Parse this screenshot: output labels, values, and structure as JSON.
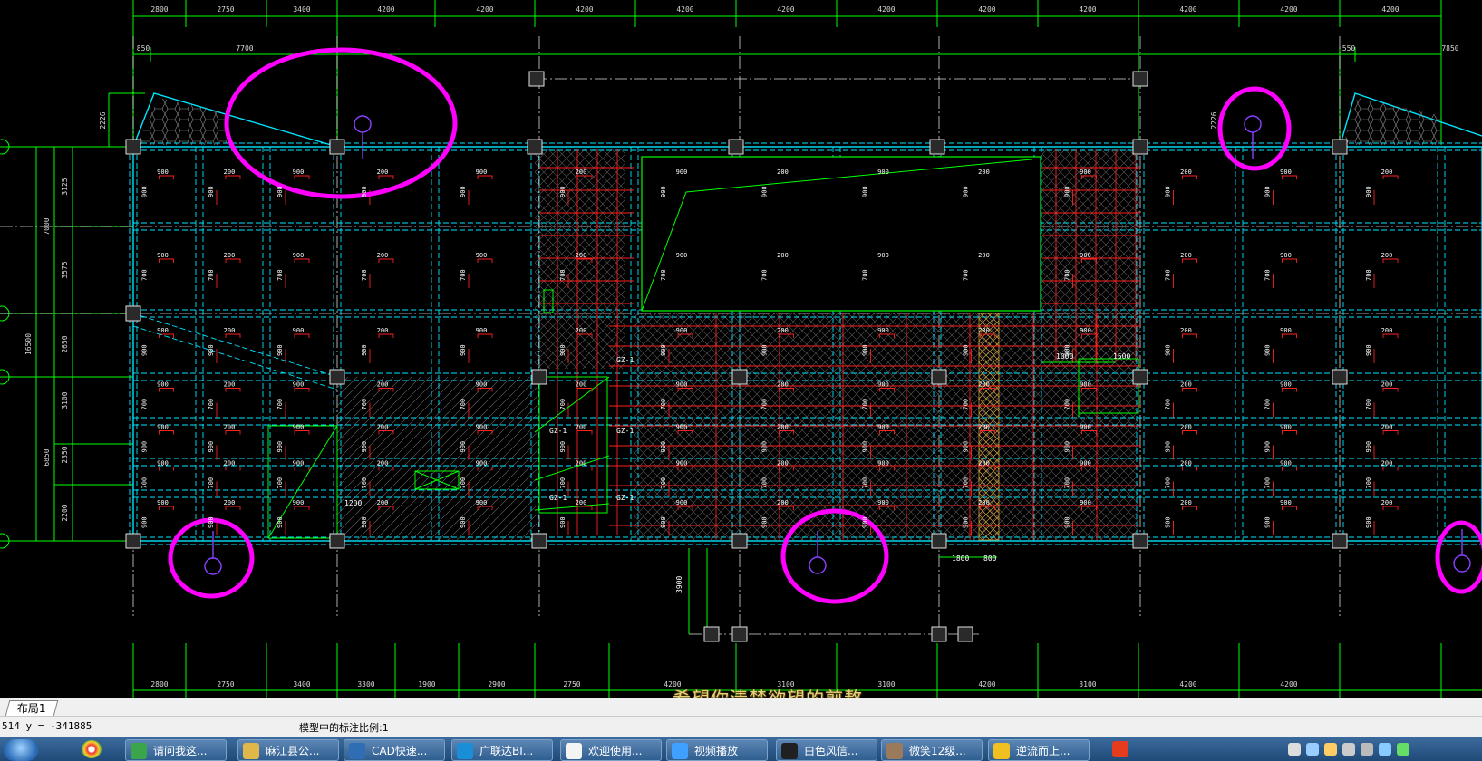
{
  "drawing": {
    "top_dims": [
      "2800",
      "2750",
      "3400",
      "4200",
      "4200",
      "4200",
      "4200",
      "4200",
      "4200",
      "4200",
      "4200",
      "4200",
      "4200",
      "4200"
    ],
    "top_sub_dims": [
      "850",
      "7700",
      "550",
      "7850"
    ],
    "bottom_dims": [
      "2800",
      "2750",
      "3400",
      "3300",
      "1900",
      "2900",
      "2750",
      "4200",
      "3100",
      "3100",
      "4200",
      "3100",
      "4200",
      "4200"
    ],
    "left_dims": [
      "3125",
      "3575",
      "2650",
      "3100",
      "2350",
      "2200"
    ],
    "left_totals": [
      "7000",
      "16500",
      "6850"
    ],
    "left_small": [
      "2226",
      "2226"
    ],
    "labels": {
      "dim_1000": "1000",
      "dim_1500": "1500",
      "dim_1800": "1800",
      "dim_800": "800",
      "dim_1200": "1200",
      "dim_3900": "3900",
      "gz1": "GZ-1",
      "b900": "900",
      "b200": "200",
      "b700": "700"
    }
  },
  "caption": "希望你清楚欲望的煎熬",
  "layout_tab": "布局1",
  "status": {
    "coords": "514 y = -341885",
    "scale": "模型中的标注比例:1"
  },
  "taskbar": {
    "items": [
      {
        "label": "请问我这...",
        "color": "#3aa54a"
      },
      {
        "label": "麻江县公...",
        "color": "#e0b84a"
      },
      {
        "label": "CAD快速...",
        "color": "#2f6db5"
      },
      {
        "label": "广联达BI...",
        "color": "#1a8fd8"
      },
      {
        "label": "欢迎使用...",
        "color": "#f4f4f4"
      },
      {
        "label": "视频播放",
        "color": "#3fa0ff"
      },
      {
        "label": "白色风信...",
        "color": "#202020"
      },
      {
        "label": "微笑12级...",
        "color": "#9a7a5a"
      },
      {
        "label": "逆流而上...",
        "color": "#f0c020"
      }
    ]
  },
  "colors": {
    "grid_green": "#00ff00",
    "beam_cyan": "#00e5ff",
    "rebar_red": "#ff2020",
    "highlight_magenta": "#ff00ff",
    "axis_white": "#ffffff"
  }
}
